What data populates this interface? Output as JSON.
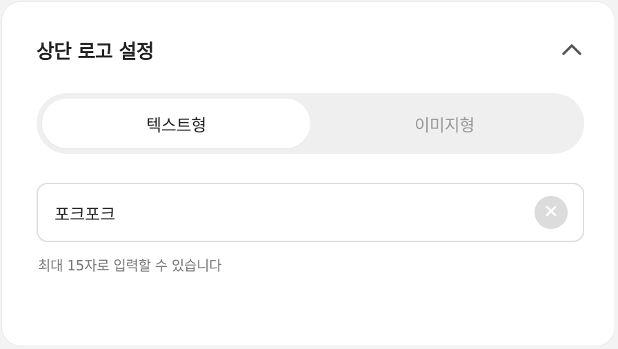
{
  "section": {
    "title": "상단 로고 설정",
    "collapse_icon": "chevron-up-icon"
  },
  "logo_type": {
    "options": [
      "텍스트형",
      "이미지형"
    ],
    "selected": "텍스트형"
  },
  "logo_text": {
    "value": "포크포크",
    "clear_icon": "close-icon"
  },
  "helper_text": "최대 15자로 입력할 수 있습니다"
}
